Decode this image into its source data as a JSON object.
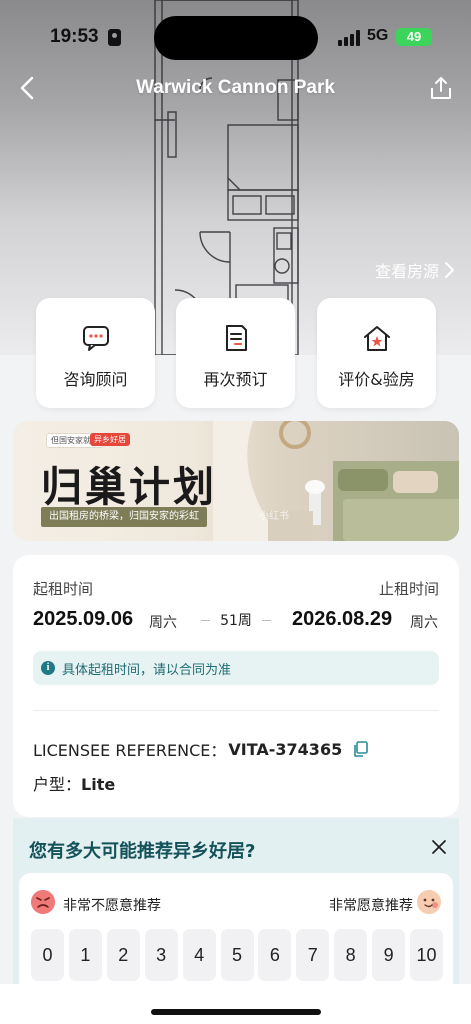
{
  "status_bar": {
    "time": "19:53",
    "network": "5G",
    "battery": "49"
  },
  "nav": {
    "title": "Warwick Cannon Park",
    "view_rooms": "查看房源"
  },
  "actions": [
    {
      "label": "咨询顾问",
      "icon": "chat-icon"
    },
    {
      "label": "再次预订",
      "icon": "document-icon"
    },
    {
      "label": "评价&验房",
      "icon": "house-star-icon"
    }
  ],
  "banner": {
    "tag_left": "但国安家就上",
    "tag_right": "异乡好居",
    "title": "归巢计划",
    "strip": "出国租房的桥梁，归国安家的彩虹",
    "watermark": "小红书"
  },
  "lease": {
    "start_label": "起租时间",
    "end_label": "止租时间",
    "start_date": "2025.09.06",
    "start_weekday": "周六",
    "duration": "51周",
    "end_date": "2026.08.29",
    "end_weekday": "周六",
    "notice": "具体起租时间，请以合同为准"
  },
  "details": {
    "reference_label": "LICENSEE REFERENCE：",
    "reference_value": "VITA-374365",
    "type_label": "户型：",
    "type_value": "Lite"
  },
  "survey": {
    "question": "您有多大可能推荐异乡好居?",
    "low_label": "非常不愿意推荐",
    "high_label": "非常愿意推荐",
    "scores": [
      "0",
      "1",
      "2",
      "3",
      "4",
      "5",
      "6",
      "7",
      "8",
      "9",
      "10"
    ]
  },
  "colors": {
    "accent_teal": "#14525a",
    "battery_green": "#3dd45c",
    "notice_bg": "#e7f3f3"
  }
}
